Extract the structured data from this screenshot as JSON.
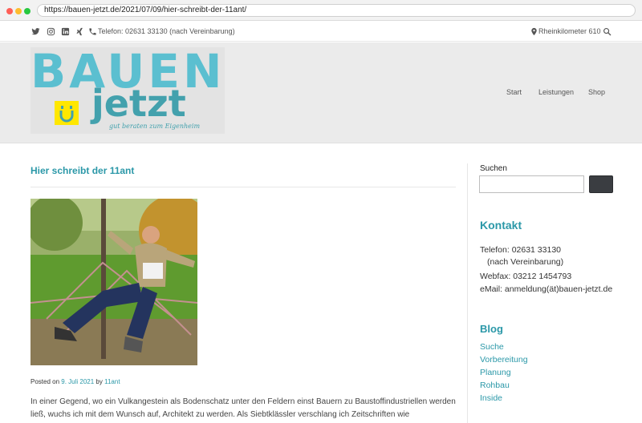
{
  "browser": {
    "url": "https://bauen-jetzt.de/2021/07/09/hier-schreibt-der-11ant/"
  },
  "topbar": {
    "social_icons": [
      "twitter-icon",
      "instagram-icon",
      "linkedin-icon",
      "xing-icon"
    ],
    "phone_text": "Telefon: 02631 33130 (nach Vereinbarung)",
    "location_text": "Rheinkilometer 610"
  },
  "logo": {
    "word_top": "BAUEN",
    "word_bottom": "jetzt",
    "tagline": "gut beraten zum Eigenheim",
    "colors": {
      "top": "#5bbfd0",
      "bottom": "#43a1ad",
      "badge": "#ffe700"
    }
  },
  "nav": {
    "items": [
      "Start",
      "Leistungen",
      "Shop"
    ]
  },
  "post": {
    "title": "Hier schreibt der 11ant",
    "meta_prefix": "Posted on",
    "date": "9. Juli 2021",
    "by": "by",
    "author": "11ant",
    "body": "In einer Gegend, wo ein Vulkangestein als Bodenschatz unter den Feldern einst Bauern zu Baustoffindustriellen werden ließ, wuchs ich mit dem Wunsch auf, Architekt zu werden. Als Siebtklässler verschlang ich Zeitschriften wie"
  },
  "sidebar": {
    "search_label": "Suchen",
    "search_value": "",
    "contact": {
      "heading": "Kontakt",
      "phone": "Telefon: 02631 33130",
      "phone_note": "(nach Vereinbarung)",
      "fax": "Webfax: 03212 1454793",
      "email": "eMail: anmeldung(ät)bauen-jetzt.de"
    },
    "blog": {
      "heading": "Blog",
      "links": [
        "Suche",
        "Vorbereitung",
        "Planung",
        "Rohbau",
        "Inside"
      ]
    }
  },
  "colors": {
    "accent": "#2b98a8",
    "header_bg": "#ebebeb"
  }
}
